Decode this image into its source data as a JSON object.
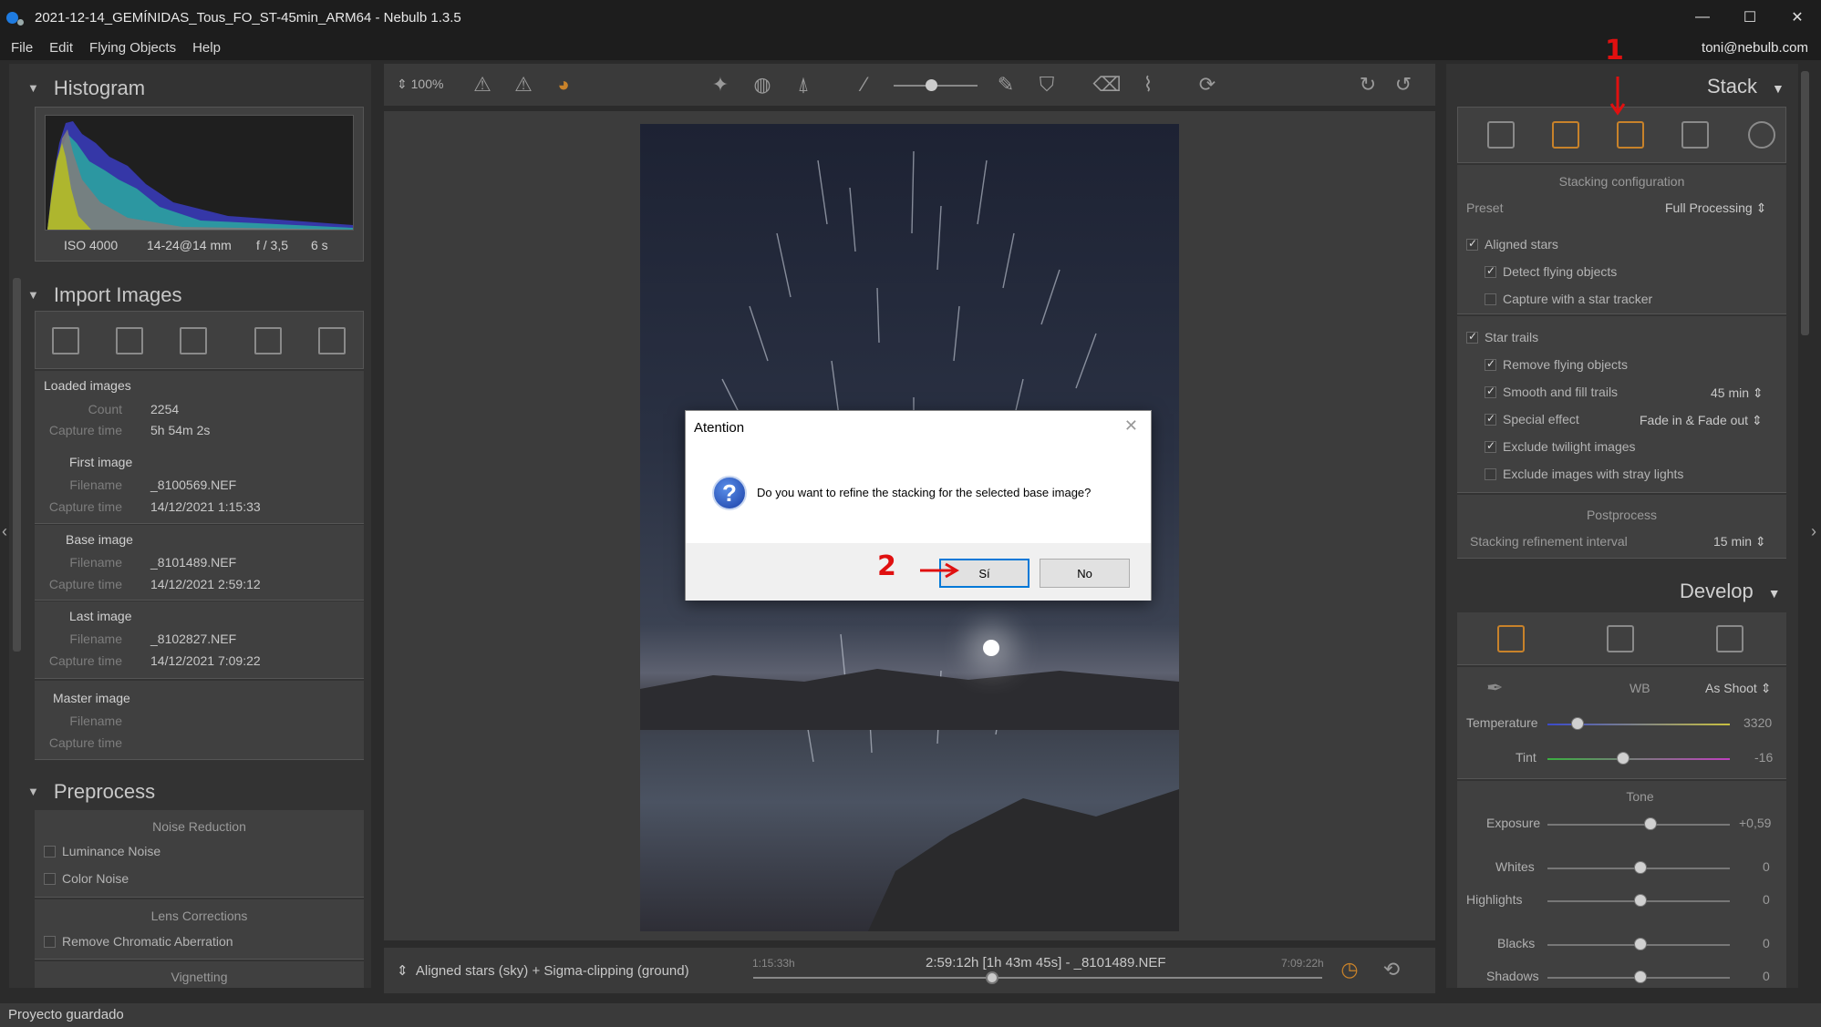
{
  "window": {
    "title": "2021-12-14_GEMÍNIDAS_Tous_FO_ST-45min_ARM64 - Nebulb 1.3.5",
    "minimize": "—",
    "maximize": "☐",
    "close": "✕"
  },
  "menu": {
    "items": [
      "File",
      "Edit",
      "Flying Objects",
      "Help"
    ],
    "user": "toni@nebulb.com"
  },
  "histogram": {
    "title": "Histogram",
    "iso": "ISO 4000",
    "lens": "14-24@14 mm",
    "aperture": "f / 3,5",
    "exposure": "6 s"
  },
  "import": {
    "title": "Import Images",
    "loaded": {
      "title": "Loaded images",
      "count_label": "Count",
      "count": "2254",
      "capture_label": "Capture time",
      "capture": "5h 54m 2s"
    },
    "first": {
      "title": "First image",
      "filename_label": "Filename",
      "filename": "_8100569.NEF",
      "capture_label": "Capture time",
      "capture": "14/12/2021 1:15:33"
    },
    "base": {
      "title": "Base image",
      "filename_label": "Filename",
      "filename": "_8101489.NEF",
      "capture_label": "Capture time",
      "capture": "14/12/2021 2:59:12"
    },
    "last": {
      "title": "Last image",
      "filename_label": "Filename",
      "filename": "_8102827.NEF",
      "capture_label": "Capture time",
      "capture": "14/12/2021 7:09:22"
    },
    "master": {
      "title": "Master image",
      "filename_label": "Filename",
      "capture_label": "Capture time"
    }
  },
  "preprocess": {
    "title": "Preprocess",
    "noise_title": "Noise Reduction",
    "luminance": "Luminance Noise",
    "color": "Color Noise",
    "lens_title": "Lens Corrections",
    "chromatic": "Remove Chromatic Aberration",
    "vignetting": "Vignetting"
  },
  "toolbar": {
    "zoom": "100%"
  },
  "timeline": {
    "mode": "Aligned stars (sky) + Sigma-clipping (ground)",
    "start": "1:15:33h",
    "center": "2:59:12h [1h 43m 45s] - _8101489.NEF",
    "end": "7:09:22h"
  },
  "stack": {
    "title": "Stack",
    "config_title": "Stacking configuration",
    "preset_label": "Preset",
    "preset_value": "Full Processing",
    "aligned": "Aligned stars",
    "detect": "Detect flying objects",
    "tracker": "Capture with a star tracker",
    "trails": "Star trails",
    "remove": "Remove flying objects",
    "smooth": "Smooth and fill trails",
    "smooth_value": "45 min",
    "special": "Special effect",
    "special_value": "Fade in & Fade out",
    "twilight": "Exclude twilight images",
    "stray": "Exclude images with stray lights",
    "post_title": "Postprocess",
    "refine_label": "Stacking refinement interval",
    "refine_value": "15 min"
  },
  "develop": {
    "title": "Develop",
    "wb_label": "WB",
    "wb_value": "As Shoot",
    "temp_label": "Temperature",
    "temp_value": "3320",
    "tint_label": "Tint",
    "tint_value": "-16",
    "tone_title": "Tone",
    "exposure_label": "Exposure",
    "exposure_value": "+0,59",
    "whites_label": "Whites",
    "whites_value": "0",
    "highlights_label": "Highlights",
    "highlights_value": "0",
    "blacks_label": "Blacks",
    "blacks_value": "0",
    "shadows_label": "Shadows",
    "shadows_value": "0"
  },
  "dialog": {
    "title": "Atention",
    "message": "Do you want to refine the stacking for the selected base image?",
    "yes": "Sí",
    "no": "No"
  },
  "annotations": {
    "step1": "1",
    "step2": "2"
  },
  "status": "Proyecto guardado",
  "colors": {
    "accent_orange": "#c8822a",
    "dialog_default_border": "#0078d7",
    "annotation_red": "#e01010"
  }
}
